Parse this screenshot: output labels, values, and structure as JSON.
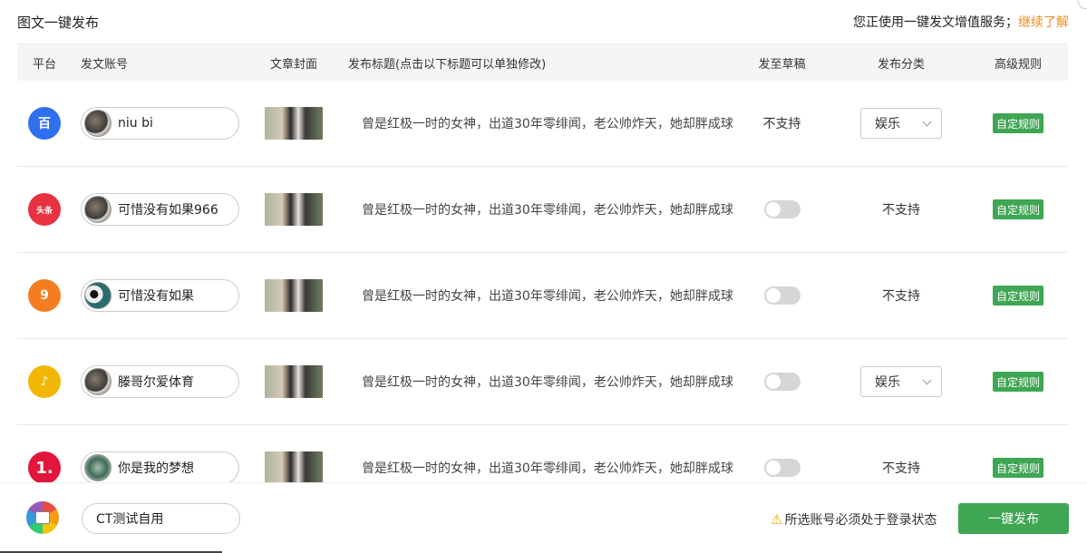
{
  "header": {
    "title": "图文一键发布",
    "notice_text": "您正使用一键发文增值服务；",
    "notice_link": "继续了解"
  },
  "columns": {
    "platform": "平台",
    "account": "发文账号",
    "cover": "文章封面",
    "title": "发布标题(点击以下标题可以单独修改)",
    "draft": "发至草稿",
    "category": "发布分类",
    "rules": "高级规则"
  },
  "rows": [
    {
      "platform_icon": "baijiahao-icon",
      "platform_color": "#2f6ff0",
      "platform_glyph": "百",
      "account_name": "niu bi",
      "title": "曾是红极一时的女神，出道30年零绯闻，老公帅炸天，她却胖成球",
      "draft": "不支持",
      "category": "娱乐",
      "rule_button": "自定规则"
    },
    {
      "platform_icon": "toutiao-icon",
      "platform_color": "#e8323f",
      "platform_glyph": "头条",
      "account_name": "可惜没有如果966",
      "title": "曾是红极一时的女神，出道30年零绯闻，老公帅炸天，她却胖成球",
      "draft": "off",
      "category": "不支持",
      "rule_button": "自定规则"
    },
    {
      "platform_icon": "dayu-icon",
      "platform_color": "#f57d1f",
      "platform_glyph": "9",
      "account_name": "可惜没有如果",
      "title": "曾是红极一时的女神，出道30年零绯闻，老公帅炸天，她却胖成球",
      "draft": "off",
      "category": "不支持",
      "rule_button": "自定规则"
    },
    {
      "platform_icon": "qq-icon",
      "platform_color": "#f2b705",
      "platform_glyph": "♪",
      "account_name": "滕哥尔爱体育",
      "title": "曾是红极一时的女神，出道30年零绯闻，老公帅炸天，她却胖成球",
      "draft": "off",
      "category": "娱乐",
      "rule_button": "自定规则"
    },
    {
      "platform_icon": "yidian-icon",
      "platform_color": "#e2153b",
      "platform_glyph": "1.",
      "account_name": "你是我的梦想",
      "title": "曾是红极一时的女神，出道30年零绯闻，老公帅炸天，她却胖成球",
      "draft": "off",
      "category": "不支持",
      "rule_button": "自定规则"
    }
  ],
  "footer": {
    "group_name": "CT测试自用",
    "warning": "所选账号必须处于登录状态",
    "publish_button": "一键发布"
  }
}
